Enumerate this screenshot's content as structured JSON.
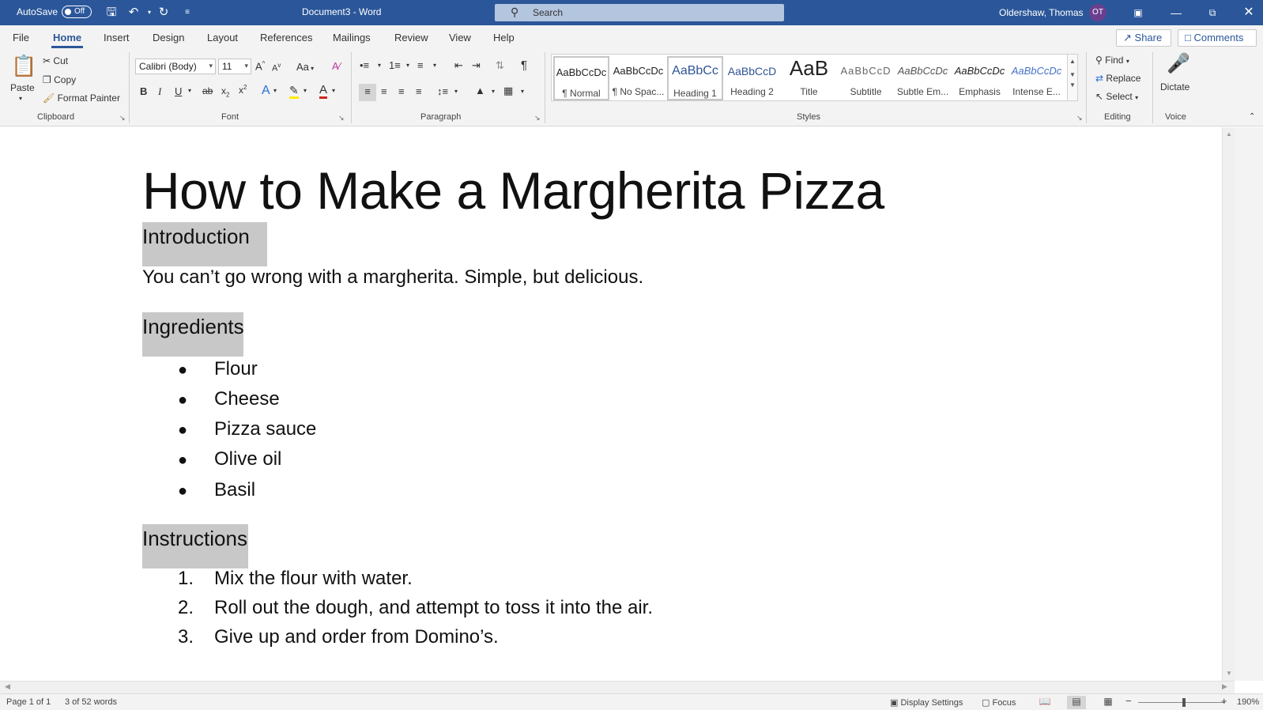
{
  "titlebar": {
    "autosave_label": "AutoSave",
    "autosave_state": "Off",
    "document_title": "Document3 - Word",
    "search_placeholder": "Search",
    "user_name": "Oldershaw, Thomas",
    "user_initials": "OT"
  },
  "tabs": [
    "File",
    "Home",
    "Insert",
    "Design",
    "Layout",
    "References",
    "Mailings",
    "Review",
    "View",
    "Help"
  ],
  "active_tab": "Home",
  "share_label": "Share",
  "comments_label": "Comments",
  "ribbon": {
    "clipboard": {
      "paste": "Paste",
      "cut": "Cut",
      "copy": "Copy",
      "format_painter": "Format Painter",
      "group_label": "Clipboard"
    },
    "font": {
      "font_name": "Calibri (Body)",
      "font_size": "11",
      "change_case": "Aa",
      "group_label": "Font"
    },
    "paragraph": {
      "group_label": "Paragraph"
    },
    "styles": {
      "group_label": "Styles",
      "items": [
        {
          "preview": "AaBbCcDc",
          "name": "¶ Normal",
          "color": "#222222"
        },
        {
          "preview": "AaBbCcDc",
          "name": "¶ No Spac...",
          "color": "#222222"
        },
        {
          "preview": "AaBbCc",
          "name": "Heading 1",
          "color": "#2f5496"
        },
        {
          "preview": "AaBbCcD",
          "name": "Heading 2",
          "color": "#2f5496"
        },
        {
          "preview": "AaB",
          "name": "Title",
          "color": "#222222"
        },
        {
          "preview": "AaBbCcD",
          "name": "Subtitle",
          "color": "#666666"
        },
        {
          "preview": "AaBbCcDc",
          "name": "Subtle Em...",
          "color": "#555555"
        },
        {
          "preview": "AaBbCcDc",
          "name": "Emphasis",
          "color": "#222222"
        },
        {
          "preview": "AaBbCcDc",
          "name": "Intense E...",
          "color": "#4472c4"
        }
      ]
    },
    "editing": {
      "find": "Find",
      "replace": "Replace",
      "select": "Select",
      "group_label": "Editing"
    },
    "voice": {
      "dictate": "Dictate",
      "group_label": "Voice"
    }
  },
  "document": {
    "title": "How to Make a Margherita Pizza",
    "introduction_heading": "Introduction",
    "introduction_text": "You can’t go wrong with a margherita. Simple, but delicious.",
    "ingredients_heading": "Ingredients",
    "ingredients": [
      "Flour",
      "Cheese",
      "Pizza sauce",
      "Olive oil",
      "Basil"
    ],
    "instructions_heading": "Instructions",
    "instructions": [
      {
        "num": "1.",
        "text": "Mix the flour with water."
      },
      {
        "num": "2.",
        "text": "Roll out the dough, and attempt to toss it into the air."
      },
      {
        "num": "3.",
        "text": "Give up and order from Domino’s."
      }
    ]
  },
  "statusbar": {
    "page": "Page 1 of 1",
    "words": "3 of 52 words",
    "display_settings": "Display Settings",
    "focus": "Focus",
    "zoom": "190%"
  },
  "colors": {
    "titlebar_bg": "#2b579a",
    "accent": "#2b579a",
    "selection": "#c8c8c8"
  }
}
